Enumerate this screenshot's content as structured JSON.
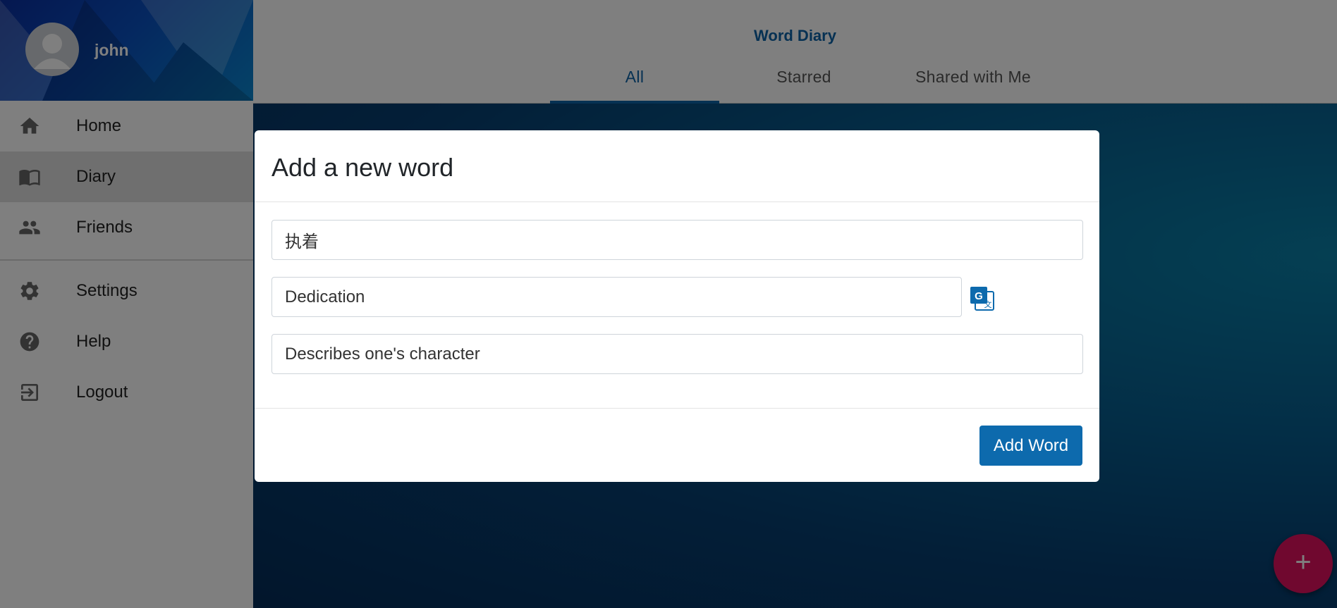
{
  "user": {
    "name": "john"
  },
  "sidebar": {
    "items": [
      {
        "label": "Home",
        "icon": "home-icon"
      },
      {
        "label": "Diary",
        "icon": "book-icon",
        "active": true
      },
      {
        "label": "Friends",
        "icon": "people-icon"
      },
      {
        "label": "Settings",
        "icon": "gear-icon"
      },
      {
        "label": "Help",
        "icon": "help-icon"
      },
      {
        "label": "Logout",
        "icon": "logout-icon"
      }
    ]
  },
  "header": {
    "title": "Word Diary",
    "tabs": [
      {
        "label": "All",
        "active": true
      },
      {
        "label": "Starred"
      },
      {
        "label": "Shared with Me"
      }
    ]
  },
  "modal": {
    "title": "Add a new word",
    "word_value": "执着",
    "translation_value": "Dedication",
    "note_value": "Describes one's character",
    "translate_icon": "google-translate-icon",
    "submit_label": "Add Word"
  },
  "fab": {
    "label": "+"
  },
  "colors": {
    "brand": "#0d62a6",
    "button": "#0d6aad",
    "fab": "#e0115f",
    "overlay": "rgba(0,0,0,0.5)"
  }
}
